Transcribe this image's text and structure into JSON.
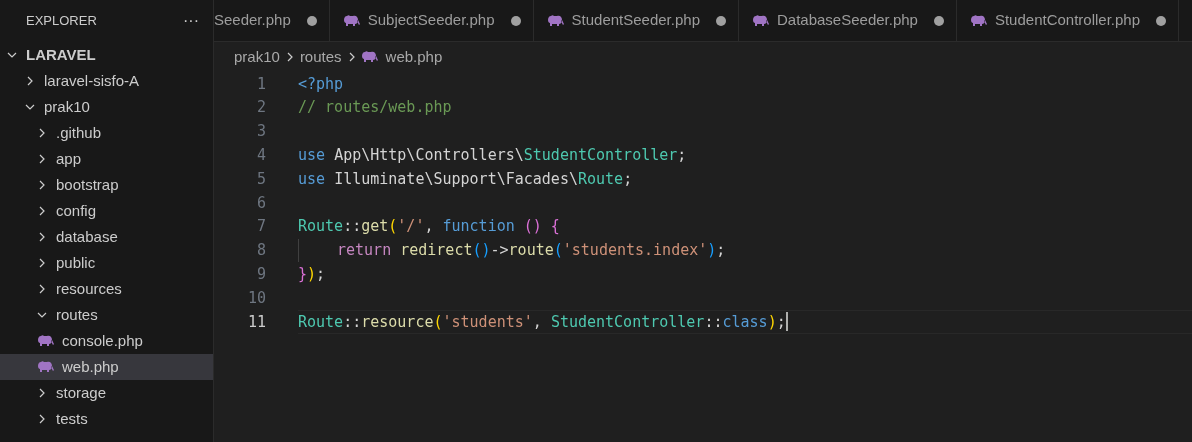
{
  "sidebar": {
    "title": "EXPLORER",
    "more_icon": "···",
    "tree": [
      {
        "label": "LARAVEL",
        "kind": "root",
        "expanded": true,
        "selected": false,
        "children": [
          {
            "label": "laravel-sisfo-A",
            "kind": "folder",
            "expanded": false,
            "selected": false
          },
          {
            "label": "prak10",
            "kind": "folder",
            "expanded": true,
            "selected": false,
            "children": [
              {
                "label": ".github",
                "kind": "folder",
                "expanded": false,
                "selected": false
              },
              {
                "label": "app",
                "kind": "folder",
                "expanded": false,
                "selected": false
              },
              {
                "label": "bootstrap",
                "kind": "folder",
                "expanded": false,
                "selected": false
              },
              {
                "label": "config",
                "kind": "folder",
                "expanded": false,
                "selected": false
              },
              {
                "label": "database",
                "kind": "folder",
                "expanded": false,
                "selected": false
              },
              {
                "label": "public",
                "kind": "folder",
                "expanded": false,
                "selected": false
              },
              {
                "label": "resources",
                "kind": "folder",
                "expanded": false,
                "selected": false
              },
              {
                "label": "routes",
                "kind": "folder",
                "expanded": true,
                "selected": false,
                "children": [
                  {
                    "label": "console.php",
                    "kind": "file",
                    "selected": false
                  },
                  {
                    "label": "web.php",
                    "kind": "file",
                    "selected": true
                  }
                ]
              },
              {
                "label": "storage",
                "kind": "folder",
                "expanded": false,
                "selected": false
              },
              {
                "label": "tests",
                "kind": "folder",
                "expanded": false,
                "selected": false
              }
            ]
          }
        ]
      }
    ]
  },
  "tabs": [
    {
      "label": "Seeder.php",
      "icon": false,
      "modified": true
    },
    {
      "label": "SubjectSeeder.php",
      "icon": true,
      "modified": true
    },
    {
      "label": "StudentSeeder.php",
      "icon": true,
      "modified": true
    },
    {
      "label": "DatabaseSeeder.php",
      "icon": true,
      "modified": true
    },
    {
      "label": "StudentController.php",
      "icon": true,
      "modified": true
    }
  ],
  "breadcrumb": [
    "prak10",
    "routes",
    "web.php"
  ],
  "editor": {
    "lines": [
      {
        "number": "1",
        "current": false,
        "tokens": [
          {
            "kind": "keyword",
            "text": "<?php"
          }
        ]
      },
      {
        "number": "2",
        "current": false,
        "tokens": [
          {
            "kind": "comment",
            "text": "// routes/web.php"
          }
        ]
      },
      {
        "number": "3",
        "current": false
      },
      {
        "number": "4",
        "current": false,
        "tokens": [
          {
            "kind": "keyword",
            "text": "use "
          },
          {
            "kind": "plain",
            "text": "App\\Http\\Controllers\\"
          },
          {
            "kind": "class",
            "text": "StudentController"
          },
          {
            "kind": "plain",
            "text": ";"
          }
        ]
      },
      {
        "number": "5",
        "current": false,
        "tokens": [
          {
            "kind": "keyword",
            "text": "use "
          },
          {
            "kind": "plain",
            "text": "Illuminate\\Support\\Facades\\"
          },
          {
            "kind": "class",
            "text": "Route"
          },
          {
            "kind": "plain",
            "text": ";"
          }
        ]
      },
      {
        "number": "6",
        "current": false
      },
      {
        "number": "7",
        "current": false,
        "tokens": [
          {
            "kind": "class",
            "text": "Route"
          },
          {
            "kind": "plain",
            "text": "::"
          },
          {
            "kind": "function",
            "text": "get"
          },
          {
            "kind": "bracket1",
            "text": "("
          },
          {
            "kind": "string",
            "text": "'/'"
          },
          {
            "kind": "plain",
            "text": ", "
          },
          {
            "kind": "keyword",
            "text": "function "
          },
          {
            "kind": "bracket2",
            "text": "() {"
          }
        ]
      },
      {
        "number": "8",
        "current": false,
        "indent": true,
        "tokens": [
          {
            "kind": "control",
            "text": "return "
          },
          {
            "kind": "function",
            "text": "redirect"
          },
          {
            "kind": "bracket3",
            "text": "()"
          },
          {
            "kind": "plain",
            "text": "->"
          },
          {
            "kind": "function",
            "text": "route"
          },
          {
            "kind": "bracket3",
            "text": "("
          },
          {
            "kind": "string",
            "text": "'students.index'"
          },
          {
            "kind": "bracket3",
            "text": ")"
          },
          {
            "kind": "plain",
            "text": ";"
          }
        ]
      },
      {
        "number": "9",
        "current": false,
        "tokens": [
          {
            "kind": "bracket2",
            "text": "}"
          },
          {
            "kind": "bracket1",
            "text": ")"
          },
          {
            "kind": "plain",
            "text": ";"
          }
        ]
      },
      {
        "number": "10",
        "current": false
      },
      {
        "number": "11",
        "current": true,
        "tokens": [
          {
            "kind": "class",
            "text": "Route"
          },
          {
            "kind": "plain",
            "text": "::"
          },
          {
            "kind": "function",
            "text": "resource"
          },
          {
            "kind": "bracket1",
            "text": "("
          },
          {
            "kind": "string",
            "text": "'students'"
          },
          {
            "kind": "plain",
            "text": ", "
          },
          {
            "kind": "class",
            "text": "StudentController"
          },
          {
            "kind": "plain",
            "text": "::"
          },
          {
            "kind": "keyword",
            "text": "class"
          },
          {
            "kind": "bracket1",
            "text": ")"
          },
          {
            "kind": "plain",
            "text": ";"
          }
        ]
      }
    ]
  }
}
